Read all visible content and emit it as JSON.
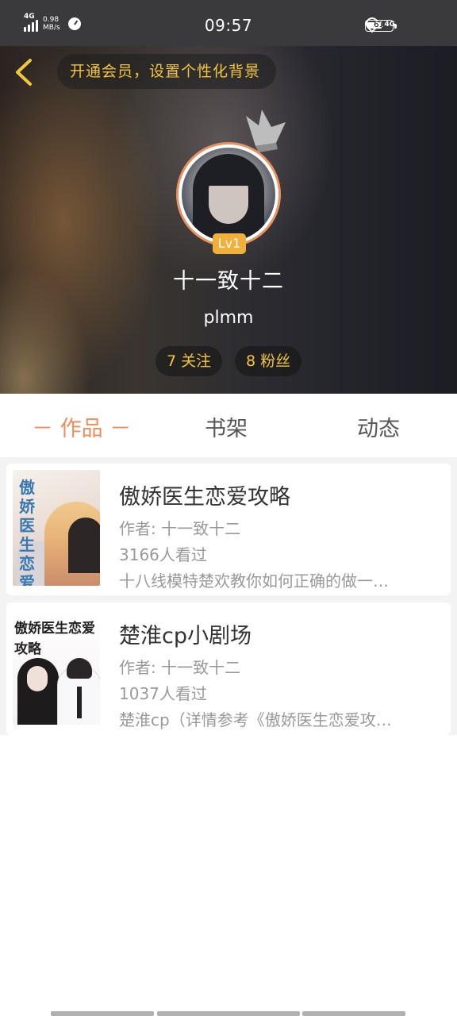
{
  "status_bar": {
    "network": "4G",
    "speed_value": "0.98",
    "speed_unit": "MB/s",
    "time": "09:57",
    "right_network": "4G",
    "battery": "61",
    "battery_level": 0.61
  },
  "header": {
    "vip_prompt": "开通会员，设置个性化背景",
    "level": "Lv1",
    "nickname": "十一致十二",
    "signature": "plmm",
    "following": "7 关注",
    "fans": "8 粉丝"
  },
  "tabs": [
    {
      "label": "－ 作品 －",
      "active": true
    },
    {
      "label": "书架",
      "active": false
    },
    {
      "label": "动态",
      "active": false
    }
  ],
  "works": [
    {
      "cover_title": "傲娇医生恋爱攻略",
      "title": "傲娇医生恋爱攻略",
      "author": "作者: 十一致十二",
      "views": "3166人看过",
      "desc": "十八线模特楚欢教你如何正确的做一…"
    },
    {
      "cover_title": "傲娇医生恋爱攻略",
      "title": "楚淮cp小剧场",
      "author": "作者: 十一致十二",
      "views": "1037人看过",
      "desc": "楚淮cp（详情参考《傲娇医生恋爱攻…"
    }
  ],
  "colors": {
    "accent": "#ef8d5a",
    "gold": "#f3c53c",
    "level_badge": "#f0b03a"
  }
}
